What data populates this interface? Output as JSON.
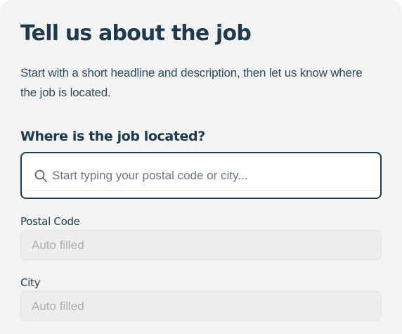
{
  "form": {
    "title": "Tell us about the job",
    "description": "Start with a short headline and description, then let us know where the job is located.",
    "location_heading": "Where is the job located?",
    "search": {
      "placeholder": "Start typing your postal code or city...",
      "value": "",
      "icon": "search-icon"
    },
    "postal_code": {
      "label": "Postal Code",
      "placeholder": "Auto filled"
    },
    "city": {
      "label": "City",
      "placeholder": "Auto filled"
    }
  },
  "colors": {
    "heading": "#1e3a4f",
    "body_text": "#2d4a5e",
    "card_background": "#f3f3f3",
    "input_border_active": "#1e3a4f",
    "disabled_field_background": "#eceded",
    "disabled_text": "#a9adb1"
  }
}
